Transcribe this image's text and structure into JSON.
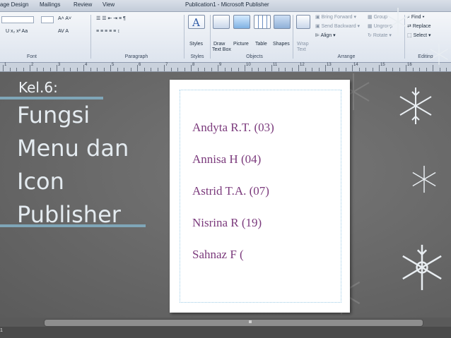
{
  "window": {
    "title": "Publication1 - Microsoft Publisher"
  },
  "tabs": [
    "age Design",
    "Mailings",
    "Review",
    "View"
  ],
  "ribbon": {
    "groups": {
      "font": "Font",
      "paragraph": "Paragraph",
      "styles": "Styles",
      "objects": "Objects",
      "arrange": "Arrange",
      "editing": "Editing"
    },
    "styles_button": "Styles",
    "draw_text_box": [
      "Draw",
      "Text Box"
    ],
    "picture": "Picture",
    "table": "Table",
    "shapes": "Shapes",
    "wrap_text": [
      "Wrap",
      "Text"
    ],
    "bring_forward": "Bring Forward",
    "send_backward": "Send Backward",
    "align": "Align",
    "group": "Group",
    "ungroup": "Ungroup",
    "rotate": "Rotate",
    "find": "Find",
    "replace": "Replace",
    "select": "Select"
  },
  "slide": {
    "kel": "Kel.6:",
    "title_lines": [
      "Fungsi",
      "Menu dan",
      "Icon",
      "Publisher"
    ]
  },
  "page": {
    "names": [
      "Andyta R.T. (03)",
      "Annisa H (04)",
      "Astrid T.A. (07)",
      "Nisrina R (19)",
      "Sahnaz F ("
    ]
  },
  "status": {
    "page_indicator": "1"
  },
  "ruler": {
    "numbers": [
      "1",
      "2",
      "3",
      "4",
      "5",
      "6",
      "7",
      "8",
      "9",
      "10",
      "11",
      "12",
      "13",
      "14",
      "15",
      "16"
    ]
  }
}
